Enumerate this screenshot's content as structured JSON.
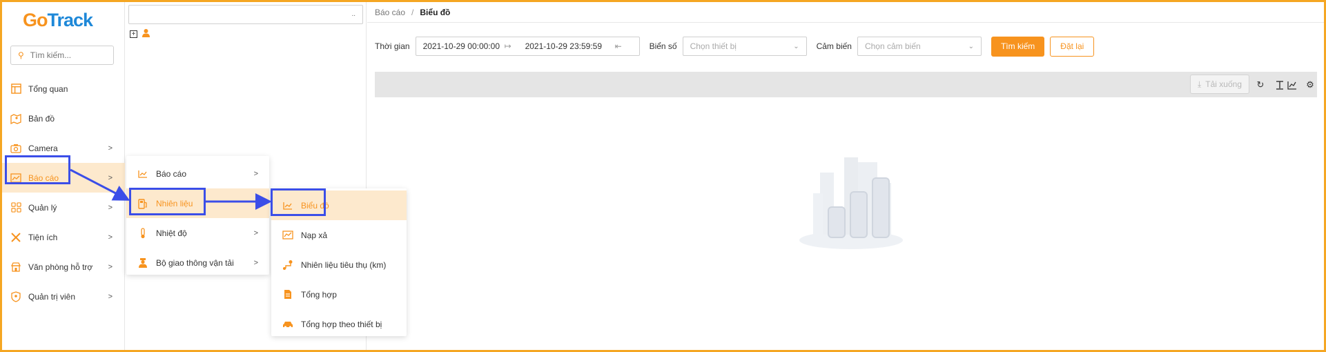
{
  "logo": {
    "go": "Go",
    "track": "Track"
  },
  "sidebar": {
    "search_placeholder": "Tìm kiếm...",
    "items": [
      {
        "label": "Tổng quan",
        "icon": "layout-icon"
      },
      {
        "label": "Bản đồ",
        "icon": "map-icon"
      },
      {
        "label": "Camera",
        "icon": "camera-icon"
      },
      {
        "label": "Báo cáo",
        "icon": "chart-icon"
      },
      {
        "label": "Quản lý",
        "icon": "grid-icon"
      },
      {
        "label": "Tiện ích",
        "icon": "tools-icon"
      },
      {
        "label": "Văn phòng hỗ trợ",
        "icon": "office-icon"
      },
      {
        "label": "Quản trị viên",
        "icon": "shield-icon"
      }
    ]
  },
  "tree": {
    "search_dots": ".."
  },
  "breadcrumb": {
    "parent": "Báo cáo",
    "sep": "/",
    "current": "Biểu đồ"
  },
  "filter": {
    "time_label": "Thời gian",
    "start": "2021-10-29 00:00:00",
    "end": "2021-10-29 23:59:59",
    "plate_label": "Biển số",
    "plate_placeholder": "Chọn thiết bị",
    "sensor_label": "Cảm biến",
    "sensor_placeholder": "Chọn cảm biến",
    "search_btn": "Tìm kiếm",
    "reset_btn": "Đặt lại"
  },
  "toolbar": {
    "download": "Tải xuống"
  },
  "menu1": [
    {
      "label": "Báo cáo",
      "chev": ">"
    },
    {
      "label": "Nhiên liệu",
      "chev": ""
    },
    {
      "label": "Nhiệt độ",
      "chev": ">"
    },
    {
      "label": "Bộ giao thông vận tải",
      "chev": ">"
    }
  ],
  "menu2": [
    {
      "label": "Biểu đồ"
    },
    {
      "label": "Nạp xả"
    },
    {
      "label": "Nhiên liệu tiêu thụ (km)"
    },
    {
      "label": "Tổng hợp"
    },
    {
      "label": "Tổng hợp theo thiết bị"
    }
  ],
  "colors": {
    "accent": "#f7931e",
    "highlight": "#3b4ee8",
    "active_bg": "#fde9cd"
  }
}
